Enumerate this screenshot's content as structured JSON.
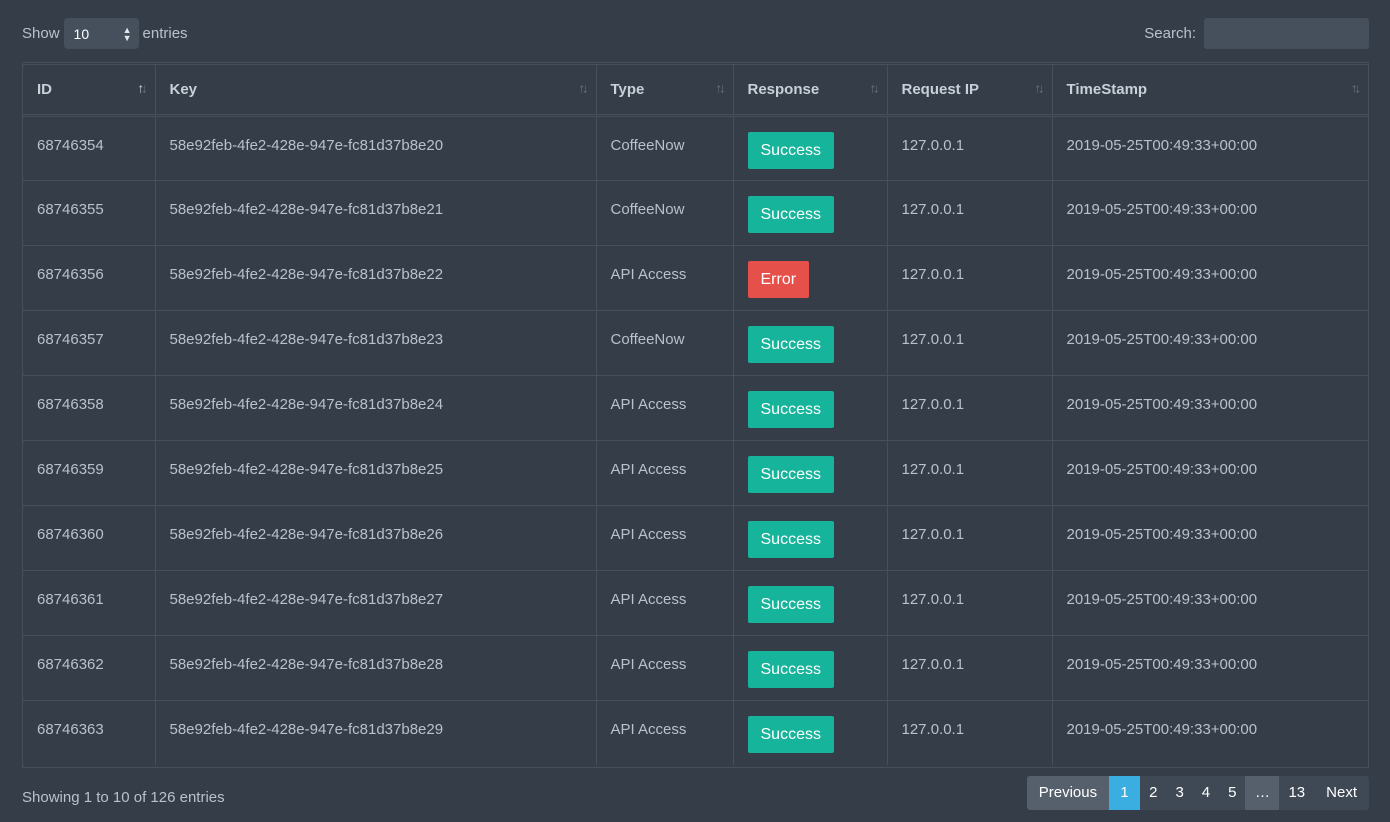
{
  "length_menu": {
    "show_label": "Show",
    "value": "10",
    "entries_label": "entries"
  },
  "search": {
    "label": "Search:",
    "value": ""
  },
  "colors": {
    "success": "#16b49b",
    "error": "#e5504b",
    "active_page": "#3aaee0"
  },
  "table": {
    "headers": [
      "ID",
      "Key",
      "Type",
      "Response",
      "Request IP",
      "TimeStamp"
    ],
    "rows": [
      {
        "id": "68746354",
        "key": "58e92feb-4fe2-428e-947e-fc81d37b8e20",
        "type": "CoffeeNow",
        "response": "Success",
        "ip": "127.0.0.1",
        "ts": "2019-05-25T00:49:33+00:00"
      },
      {
        "id": "68746355",
        "key": "58e92feb-4fe2-428e-947e-fc81d37b8e21",
        "type": "CoffeeNow",
        "response": "Success",
        "ip": "127.0.0.1",
        "ts": "2019-05-25T00:49:33+00:00"
      },
      {
        "id": "68746356",
        "key": "58e92feb-4fe2-428e-947e-fc81d37b8e22",
        "type": "API Access",
        "response": "Error",
        "ip": "127.0.0.1",
        "ts": "2019-05-25T00:49:33+00:00"
      },
      {
        "id": "68746357",
        "key": "58e92feb-4fe2-428e-947e-fc81d37b8e23",
        "type": "CoffeeNow",
        "response": "Success",
        "ip": "127.0.0.1",
        "ts": "2019-05-25T00:49:33+00:00"
      },
      {
        "id": "68746358",
        "key": "58e92feb-4fe2-428e-947e-fc81d37b8e24",
        "type": "API Access",
        "response": "Success",
        "ip": "127.0.0.1",
        "ts": "2019-05-25T00:49:33+00:00"
      },
      {
        "id": "68746359",
        "key": "58e92feb-4fe2-428e-947e-fc81d37b8e25",
        "type": "API Access",
        "response": "Success",
        "ip": "127.0.0.1",
        "ts": "2019-05-25T00:49:33+00:00"
      },
      {
        "id": "68746360",
        "key": "58e92feb-4fe2-428e-947e-fc81d37b8e26",
        "type": "API Access",
        "response": "Success",
        "ip": "127.0.0.1",
        "ts": "2019-05-25T00:49:33+00:00"
      },
      {
        "id": "68746361",
        "key": "58e92feb-4fe2-428e-947e-fc81d37b8e27",
        "type": "API Access",
        "response": "Success",
        "ip": "127.0.0.1",
        "ts": "2019-05-25T00:49:33+00:00"
      },
      {
        "id": "68746362",
        "key": "58e92feb-4fe2-428e-947e-fc81d37b8e28",
        "type": "API Access",
        "response": "Success",
        "ip": "127.0.0.1",
        "ts": "2019-05-25T00:49:33+00:00"
      },
      {
        "id": "68746363",
        "key": "58e92feb-4fe2-428e-947e-fc81d37b8e29",
        "type": "API Access",
        "response": "Success",
        "ip": "127.0.0.1",
        "ts": "2019-05-25T00:49:33+00:00"
      }
    ]
  },
  "footer": {
    "info": "Showing 1 to 10 of 126 entries"
  },
  "pagination": {
    "previous": "Previous",
    "pages": [
      "1",
      "2",
      "3",
      "4",
      "5"
    ],
    "ellipsis": "…",
    "last": "13",
    "next": "Next"
  }
}
